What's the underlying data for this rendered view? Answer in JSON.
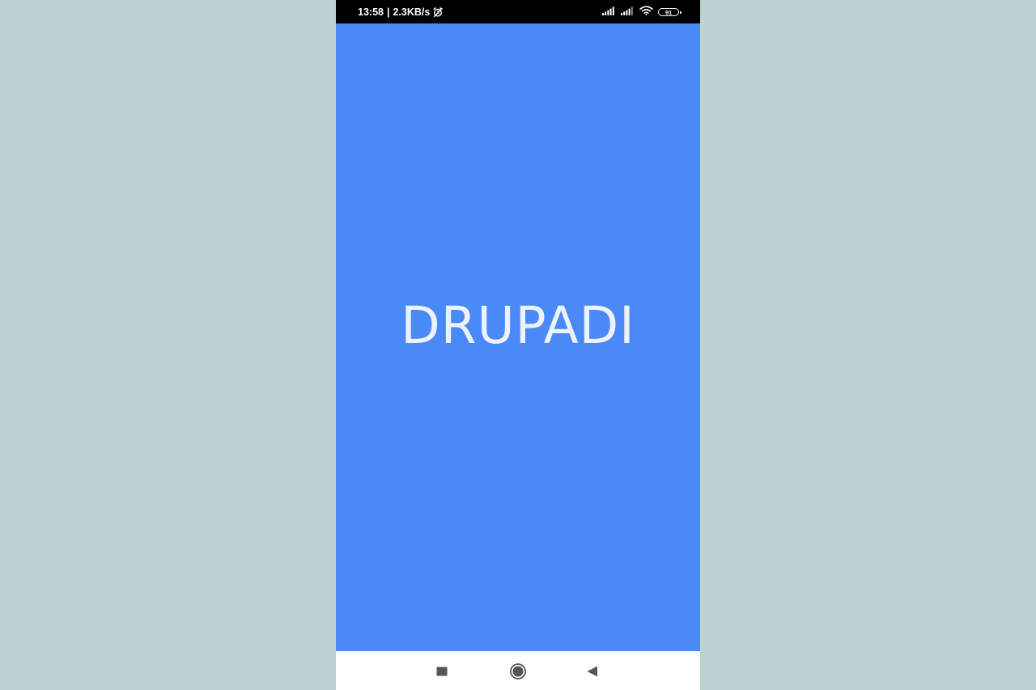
{
  "status_bar": {
    "time": "13:58",
    "separator": "|",
    "network_speed": "2.3KB/s",
    "icons_left": [
      "alarm-off-icon"
    ],
    "icons_right": [
      "signal-icon",
      "signal-icon",
      "wifi-icon",
      "battery-icon"
    ],
    "battery_level": "91"
  },
  "app": {
    "title": "DRUPADI",
    "background_color": "#4a8af8",
    "text_color": "#eef2fb"
  },
  "nav_bar": {
    "buttons": [
      "recents-button",
      "home-button",
      "back-button"
    ]
  },
  "colors": {
    "page_background": "#bed1d2",
    "status_bar": "#000000",
    "nav_bar": "#ffffff",
    "nav_icons": "#555555"
  }
}
